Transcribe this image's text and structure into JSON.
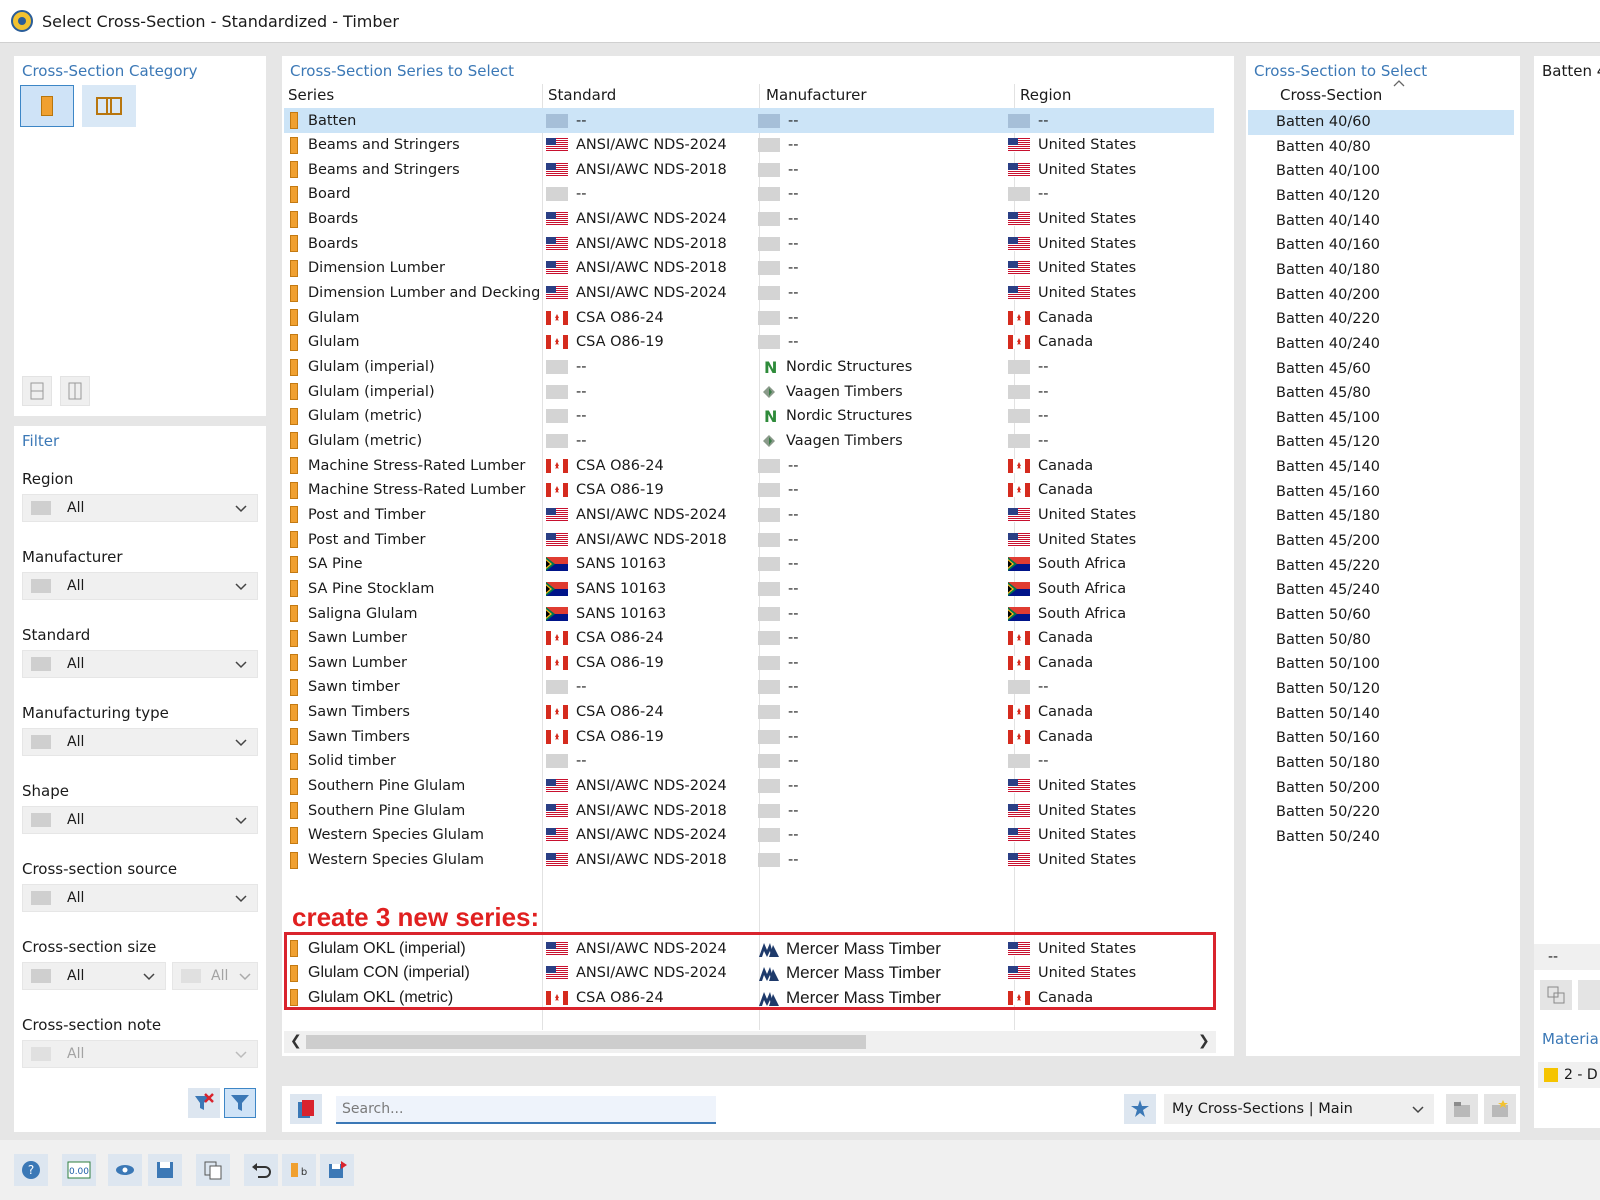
{
  "window": {
    "title": "Select Cross-Section - Standardized - Timber"
  },
  "category": {
    "title": "Cross-Section Category",
    "buttons": [
      {
        "icon": "rectangle-section-icon",
        "selected": true
      },
      {
        "icon": "built-up-section-icon",
        "selected": false
      }
    ]
  },
  "filter": {
    "title": "Filter",
    "fields": [
      {
        "label": "Region",
        "value": "All"
      },
      {
        "label": "Manufacturer",
        "value": "All"
      },
      {
        "label": "Standard",
        "value": "All"
      },
      {
        "label": "Manufacturing type",
        "value": "All"
      },
      {
        "label": "Shape",
        "value": "All"
      },
      {
        "label": "Cross-section source",
        "value": "All"
      },
      {
        "label": "Cross-section size",
        "value": "All",
        "value2": "All"
      },
      {
        "label": "Cross-section note",
        "value": "All"
      }
    ]
  },
  "series": {
    "title": "Cross-Section Series to Select",
    "columns": [
      "Series",
      "Standard",
      "Manufacturer",
      "Region"
    ],
    "rows": [
      {
        "series": "Batten",
        "standard": "--",
        "std_flag": "none",
        "manufacturer": "--",
        "man_icon": "none",
        "region": "--",
        "reg_flag": "none",
        "selected": true
      },
      {
        "series": "Beams and Stringers",
        "standard": "ANSI/AWC NDS-2024",
        "std_flag": "us",
        "manufacturer": "--",
        "man_icon": "none",
        "region": "United States",
        "reg_flag": "us"
      },
      {
        "series": "Beams and Stringers",
        "standard": "ANSI/AWC NDS-2018",
        "std_flag": "us",
        "manufacturer": "--",
        "man_icon": "none",
        "region": "United States",
        "reg_flag": "us"
      },
      {
        "series": "Board",
        "standard": "--",
        "std_flag": "none",
        "manufacturer": "--",
        "man_icon": "none",
        "region": "--",
        "reg_flag": "none"
      },
      {
        "series": "Boards",
        "standard": "ANSI/AWC NDS-2024",
        "std_flag": "us",
        "manufacturer": "--",
        "man_icon": "none",
        "region": "United States",
        "reg_flag": "us"
      },
      {
        "series": "Boards",
        "standard": "ANSI/AWC NDS-2018",
        "std_flag": "us",
        "manufacturer": "--",
        "man_icon": "none",
        "region": "United States",
        "reg_flag": "us"
      },
      {
        "series": "Dimension Lumber",
        "standard": "ANSI/AWC NDS-2018",
        "std_flag": "us",
        "manufacturer": "--",
        "man_icon": "none",
        "region": "United States",
        "reg_flag": "us"
      },
      {
        "series": "Dimension Lumber and Decking",
        "standard": "ANSI/AWC NDS-2024",
        "std_flag": "us",
        "manufacturer": "--",
        "man_icon": "none",
        "region": "United States",
        "reg_flag": "us"
      },
      {
        "series": "Glulam",
        "standard": "CSA O86-24",
        "std_flag": "ca",
        "manufacturer": "--",
        "man_icon": "none",
        "region": "Canada",
        "reg_flag": "ca"
      },
      {
        "series": "Glulam",
        "standard": "CSA O86-19",
        "std_flag": "ca",
        "manufacturer": "--",
        "man_icon": "none",
        "region": "Canada",
        "reg_flag": "ca"
      },
      {
        "series": "Glulam (imperial)",
        "standard": "--",
        "std_flag": "none",
        "manufacturer": "Nordic Structures",
        "man_icon": "nordic",
        "region": "--",
        "reg_flag": "none"
      },
      {
        "series": "Glulam (imperial)",
        "standard": "--",
        "std_flag": "none",
        "manufacturer": "Vaagen Timbers",
        "man_icon": "vaagen",
        "region": "--",
        "reg_flag": "none"
      },
      {
        "series": "Glulam (metric)",
        "standard": "--",
        "std_flag": "none",
        "manufacturer": "Nordic Structures",
        "man_icon": "nordic",
        "region": "--",
        "reg_flag": "none"
      },
      {
        "series": "Glulam (metric)",
        "standard": "--",
        "std_flag": "none",
        "manufacturer": "Vaagen Timbers",
        "man_icon": "vaagen",
        "region": "--",
        "reg_flag": "none"
      },
      {
        "series": "Machine Stress-Rated Lumber",
        "standard": "CSA O86-24",
        "std_flag": "ca",
        "manufacturer": "--",
        "man_icon": "none",
        "region": "Canada",
        "reg_flag": "ca"
      },
      {
        "series": "Machine Stress-Rated Lumber",
        "standard": "CSA O86-19",
        "std_flag": "ca",
        "manufacturer": "--",
        "man_icon": "none",
        "region": "Canada",
        "reg_flag": "ca"
      },
      {
        "series": "Post and Timber",
        "standard": "ANSI/AWC NDS-2024",
        "std_flag": "us",
        "manufacturer": "--",
        "man_icon": "none",
        "region": "United States",
        "reg_flag": "us"
      },
      {
        "series": "Post and Timber",
        "standard": "ANSI/AWC NDS-2018",
        "std_flag": "us",
        "manufacturer": "--",
        "man_icon": "none",
        "region": "United States",
        "reg_flag": "us"
      },
      {
        "series": "SA Pine",
        "standard": "SANS 10163",
        "std_flag": "za",
        "manufacturer": "--",
        "man_icon": "none",
        "region": "South Africa",
        "reg_flag": "za"
      },
      {
        "series": "SA Pine Stocklam",
        "standard": "SANS 10163",
        "std_flag": "za",
        "manufacturer": "--",
        "man_icon": "none",
        "region": "South Africa",
        "reg_flag": "za"
      },
      {
        "series": "Saligna Glulam",
        "standard": "SANS 10163",
        "std_flag": "za",
        "manufacturer": "--",
        "man_icon": "none",
        "region": "South Africa",
        "reg_flag": "za"
      },
      {
        "series": "Sawn Lumber",
        "standard": "CSA O86-24",
        "std_flag": "ca",
        "manufacturer": "--",
        "man_icon": "none",
        "region": "Canada",
        "reg_flag": "ca"
      },
      {
        "series": "Sawn Lumber",
        "standard": "CSA O86-19",
        "std_flag": "ca",
        "manufacturer": "--",
        "man_icon": "none",
        "region": "Canada",
        "reg_flag": "ca"
      },
      {
        "series": "Sawn timber",
        "standard": "--",
        "std_flag": "none",
        "manufacturer": "--",
        "man_icon": "none",
        "region": "--",
        "reg_flag": "none"
      },
      {
        "series": "Sawn Timbers",
        "standard": "CSA O86-24",
        "std_flag": "ca",
        "manufacturer": "--",
        "man_icon": "none",
        "region": "Canada",
        "reg_flag": "ca"
      },
      {
        "series": "Sawn Timbers",
        "standard": "CSA O86-19",
        "std_flag": "ca",
        "manufacturer": "--",
        "man_icon": "none",
        "region": "Canada",
        "reg_flag": "ca"
      },
      {
        "series": "Solid timber",
        "standard": "--",
        "std_flag": "none",
        "manufacturer": "--",
        "man_icon": "none",
        "region": "--",
        "reg_flag": "none"
      },
      {
        "series": "Southern Pine Glulam",
        "standard": "ANSI/AWC NDS-2024",
        "std_flag": "us",
        "manufacturer": "--",
        "man_icon": "none",
        "region": "United States",
        "reg_flag": "us"
      },
      {
        "series": "Southern Pine Glulam",
        "standard": "ANSI/AWC NDS-2018",
        "std_flag": "us",
        "manufacturer": "--",
        "man_icon": "none",
        "region": "United States",
        "reg_flag": "us"
      },
      {
        "series": "Western Species Glulam",
        "standard": "ANSI/AWC NDS-2024",
        "std_flag": "us",
        "manufacturer": "--",
        "man_icon": "none",
        "region": "United States",
        "reg_flag": "us"
      },
      {
        "series": "Western Species Glulam",
        "standard": "ANSI/AWC NDS-2018",
        "std_flag": "us",
        "manufacturer": "--",
        "man_icon": "none",
        "region": "United States",
        "reg_flag": "us"
      }
    ],
    "annotation": "create 3 new series:",
    "new_rows": [
      {
        "series": "Glulam OKL (imperial)",
        "standard": "ANSI/AWC NDS-2024",
        "std_flag": "us",
        "manufacturer": "Mercer Mass Timber",
        "man_icon": "mercer",
        "region": "United States",
        "reg_flag": "us"
      },
      {
        "series": "Glulam CON (imperial)",
        "standard": "ANSI/AWC NDS-2024",
        "std_flag": "us",
        "manufacturer": "Mercer Mass Timber",
        "man_icon": "mercer",
        "region": "United States",
        "reg_flag": "us"
      },
      {
        "series": "Glulam OKL (metric)",
        "standard": "CSA O86-24",
        "std_flag": "ca",
        "manufacturer": "Mercer Mass Timber",
        "man_icon": "mercer",
        "region": "Canada",
        "reg_flag": "ca"
      }
    ]
  },
  "sections": {
    "title": "Cross-Section to Select",
    "column": "Cross-Section",
    "items": [
      "Batten 40/60",
      "Batten 40/80",
      "Batten 40/100",
      "Batten 40/120",
      "Batten 40/140",
      "Batten 40/160",
      "Batten 40/180",
      "Batten 40/200",
      "Batten 40/220",
      "Batten 40/240",
      "Batten 45/60",
      "Batten 45/80",
      "Batten 45/100",
      "Batten 45/120",
      "Batten 45/140",
      "Batten 45/160",
      "Batten 45/180",
      "Batten 45/200",
      "Batten 45/220",
      "Batten 45/240",
      "Batten 50/60",
      "Batten 50/80",
      "Batten 50/100",
      "Batten 50/120",
      "Batten 50/140",
      "Batten 50/160",
      "Batten 50/180",
      "Batten 50/200",
      "Batten 50/220",
      "Batten 50/240"
    ]
  },
  "preview": {
    "title": "Batten 4",
    "value": "--",
    "material_label": "Material",
    "material_value": "2 - D"
  },
  "toolbar": {
    "search_placeholder": "Search...",
    "library": "My Cross-Sections | Main"
  },
  "colors": {
    "accent": "#3b78b6",
    "selection": "#cce4f7",
    "annotation": "#e02020",
    "series_icon": "#f0a030"
  }
}
